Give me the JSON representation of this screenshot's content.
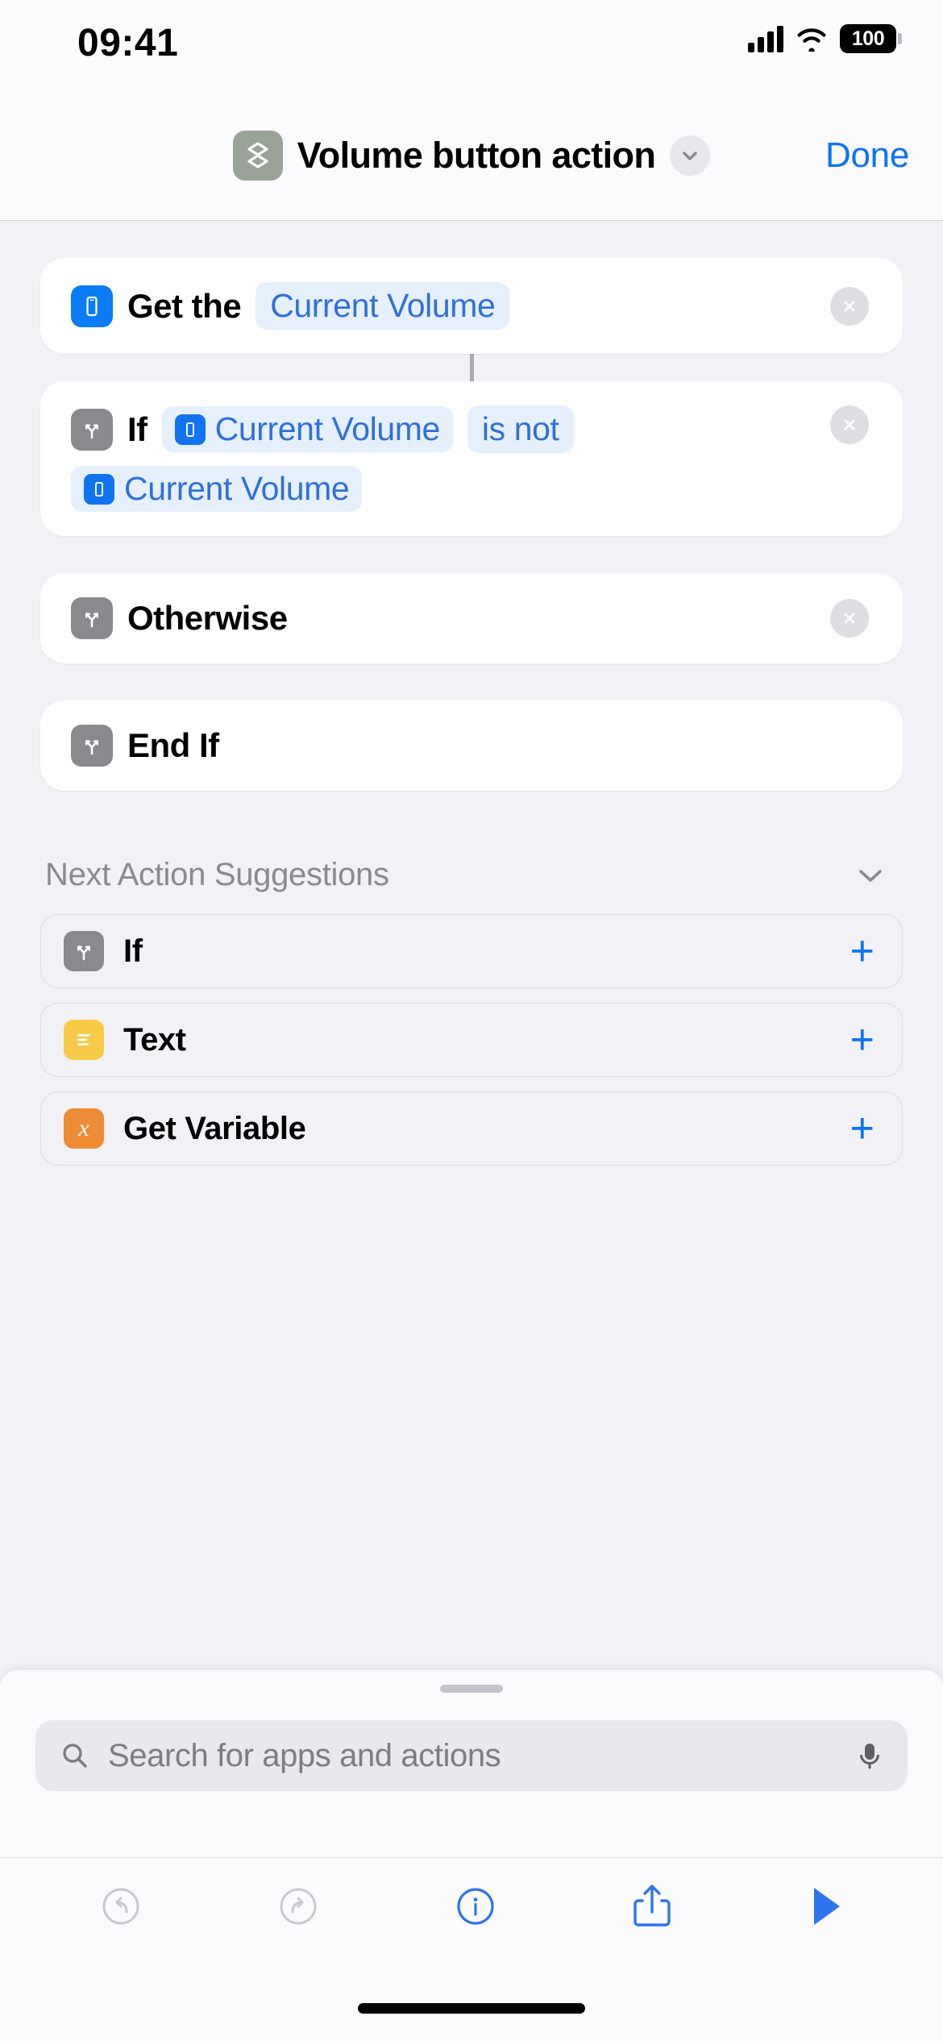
{
  "status_bar": {
    "time": "09:41",
    "battery": "100",
    "cellular_icon": "cellular-bars-icon",
    "wifi_icon": "wifi-icon",
    "battery_icon": "battery-icon"
  },
  "nav_bar": {
    "shortcut_icon": "layers-icon",
    "title": "Volume button action",
    "chevron_icon": "chevron-down-icon",
    "done_label": "Done"
  },
  "actions": [
    {
      "id": "get-current-volume",
      "icon": "iphone-icon",
      "icon_color": "#0a7cf5",
      "prefix": "Get the",
      "token": "Current Volume",
      "delete_icon": "close-circle-icon",
      "has_connector": true
    },
    {
      "id": "if-condition",
      "icon": "branch-icon",
      "icon_color": "#8a8a8e",
      "prefix": "If",
      "token_1": "Current Volume",
      "operator": "is not",
      "token_2": "Current Volume",
      "delete_icon": "close-circle-icon"
    },
    {
      "id": "otherwise",
      "icon": "branch-icon",
      "icon_color": "#8a8a8e",
      "label": "Otherwise",
      "delete_icon": "close-circle-icon"
    },
    {
      "id": "end-if",
      "icon": "branch-icon",
      "icon_color": "#8a8a8e",
      "label": "End If"
    }
  ],
  "suggestions": {
    "header": "Next Action Suggestions",
    "collapse_icon": "chevron-down-icon",
    "items": [
      {
        "id": "if",
        "label": "If",
        "icon": "branch-icon",
        "icon_color": "#8a8a8e",
        "add_icon": "plus-icon"
      },
      {
        "id": "text",
        "label": "Text",
        "icon": "text-lines-icon",
        "icon_color": "#f7cb48",
        "add_icon": "plus-icon"
      },
      {
        "id": "get-variable",
        "label": "Get Variable",
        "icon": "variable-x-icon",
        "icon_color": "#ee8c36",
        "add_icon": "plus-icon"
      }
    ]
  },
  "sheet": {
    "grabber": "sheet-grabber",
    "search": {
      "icon": "search-icon",
      "placeholder": "Search for apps and actions",
      "value": "",
      "mic_icon": "microphone-icon"
    }
  },
  "toolbar": {
    "items": [
      {
        "id": "undo",
        "icon": "undo-icon",
        "enabled": false
      },
      {
        "id": "redo",
        "icon": "redo-icon",
        "enabled": false
      },
      {
        "id": "info",
        "icon": "info-circle-icon",
        "enabled": true
      },
      {
        "id": "share",
        "icon": "share-icon",
        "enabled": true
      },
      {
        "id": "play",
        "icon": "play-icon",
        "enabled": true
      }
    ]
  },
  "colors": {
    "accent_blue": "#0b74f0",
    "token_blue": "#2f71d9",
    "token_bg": "#e6f0fd",
    "background": "#f2f1f6",
    "card": "#ffffff",
    "gray_icon": "#8a8a8e",
    "shortcut_icon_bg": "#9ba398"
  }
}
